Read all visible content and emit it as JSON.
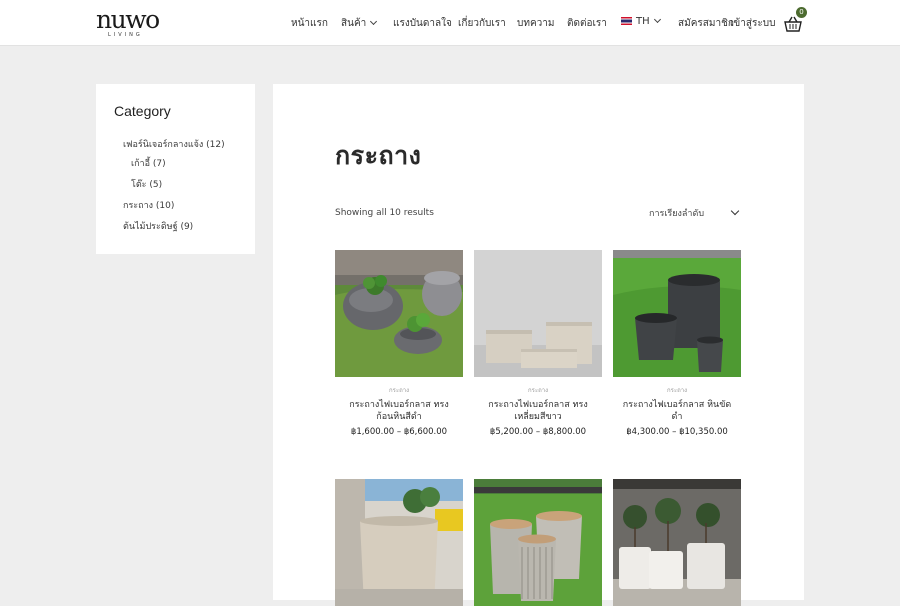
{
  "header": {
    "logo": {
      "word": "nuwo",
      "sub": "LIVING"
    },
    "nav": {
      "home": "หน้าแรก",
      "products": "สินค้า",
      "inspiration": "แรงบันดาลใจ",
      "about": "เกี่ยวกับเรา",
      "articles": "บทความ",
      "contact": "ติดต่อเรา",
      "language": "TH",
      "register": "สมัครสมาชิก",
      "login": "เข้าสู่ระบบ"
    },
    "cart_count": "0"
  },
  "sidebar": {
    "title": "Category",
    "items": [
      {
        "label": "เฟอร์นิเจอร์กลางแจ้ง (12)"
      },
      {
        "label": "เก้าอี้ (7)"
      },
      {
        "label": "โต๊ะ (5)"
      },
      {
        "label": "กระถาง (10)"
      },
      {
        "label": "ต้นไม้ประดิษฐ์ (9)"
      }
    ]
  },
  "main": {
    "title": "กระถาง",
    "results": "Showing all 10 results",
    "sort_label": "การเรียงลำดับ",
    "products": [
      {
        "category": "กระถาง",
        "name_line1": "กระถางไฟเบอร์กลาส ทรง",
        "name_line2": "ก้อนหินสีดำ",
        "price": "฿1,600.00 – ฿6,600.00"
      },
      {
        "category": "กระถาง",
        "name_line1": "กระถางไฟเบอร์กลาส ทรง",
        "name_line2": "เหลี่ยมสีขาว",
        "price": "฿5,200.00 – ฿8,800.00"
      },
      {
        "category": "กระถาง",
        "name_line1": "กระถางไฟเบอร์กลาส หินขัด",
        "name_line2": "ดำ",
        "price": "฿4,300.00 – ฿10,350.00"
      },
      {
        "category": "",
        "name_line1": "",
        "name_line2": "",
        "price": ""
      },
      {
        "category": "",
        "name_line1": "",
        "name_line2": "",
        "price": ""
      },
      {
        "category": "",
        "name_line1": "",
        "name_line2": "",
        "price": ""
      }
    ]
  },
  "colors": {
    "accent": "#4c6b2f",
    "page_bg": "#eeeeee",
    "card_bg": "#ffffff"
  }
}
